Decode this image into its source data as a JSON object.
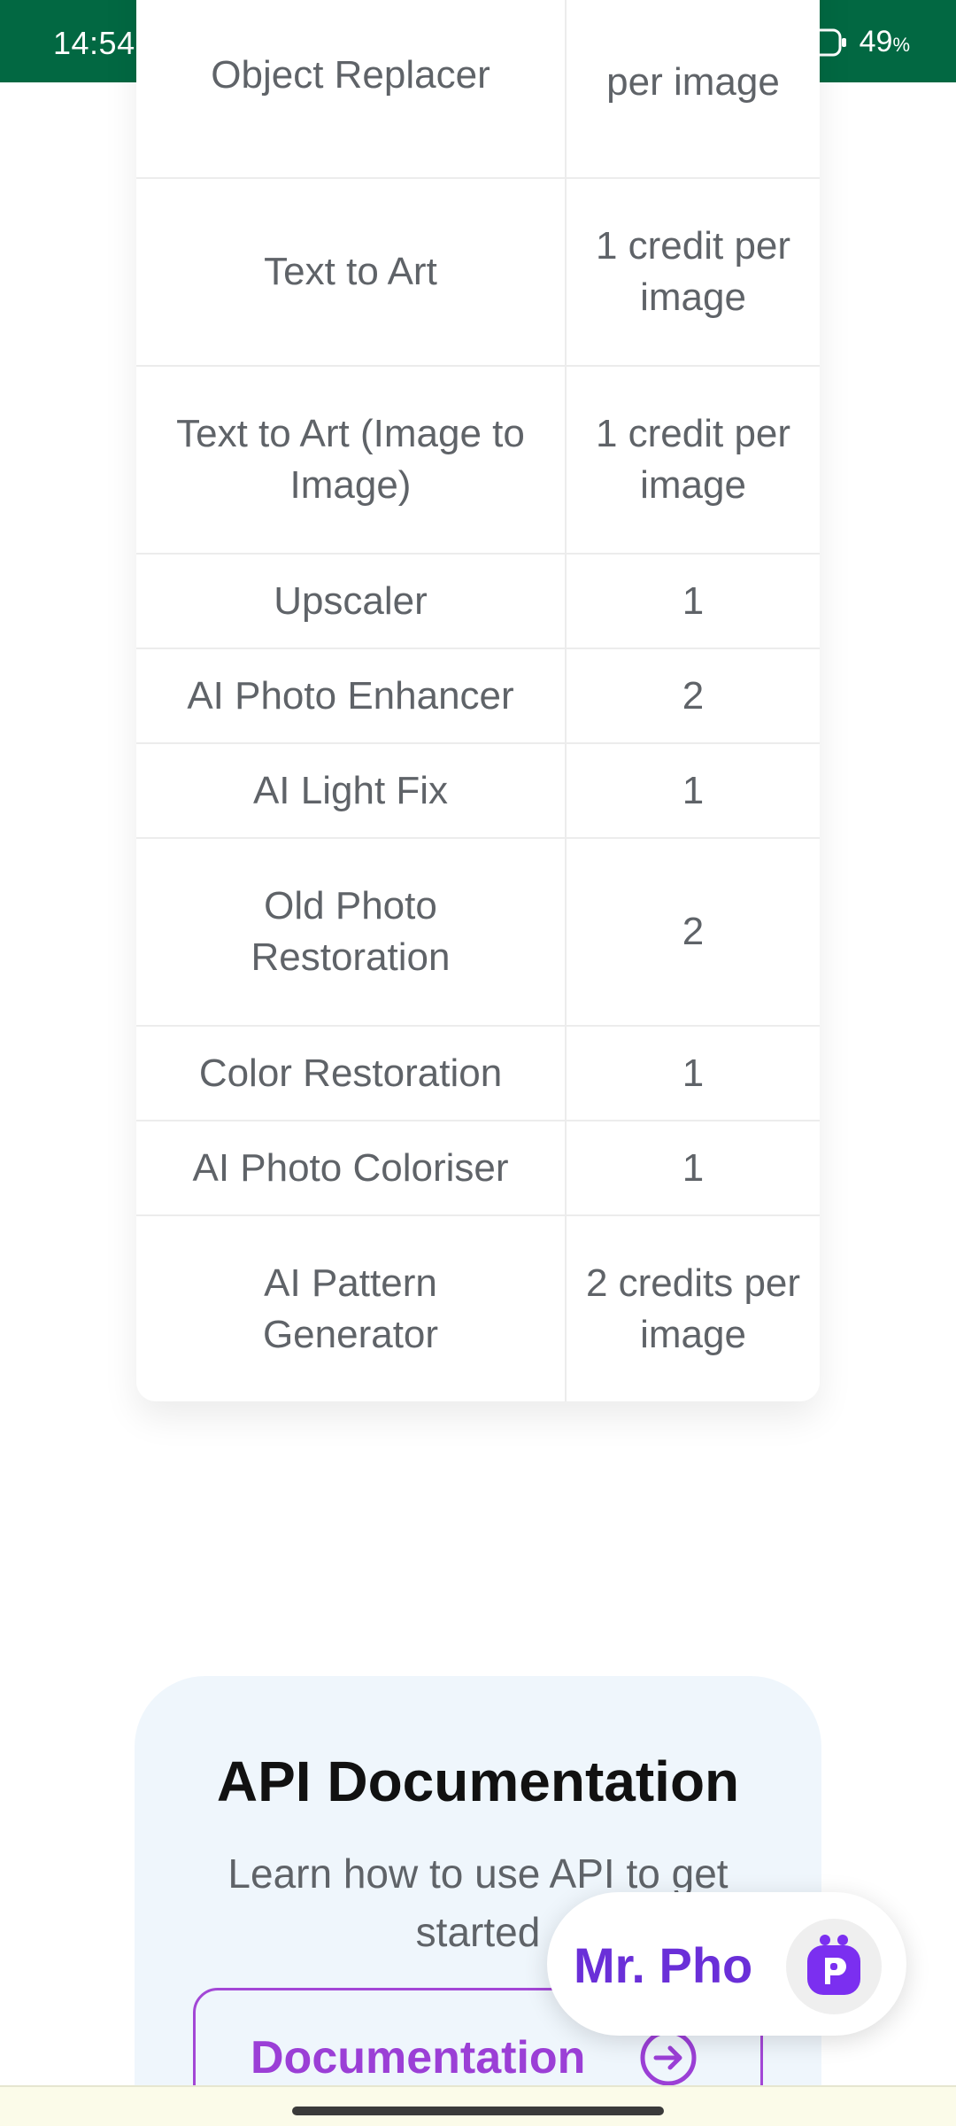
{
  "status_bar": {
    "time": "14:54",
    "battery": "49",
    "battery_unit": "%",
    "icons": [
      "chat-bubble-icon",
      "sim-toolkit-icon",
      "facebook-icon",
      "more-icon",
      "signal-icon",
      "wifi-icon",
      "battery-icon"
    ]
  },
  "credits_table": {
    "rows": [
      {
        "tool": "Object Replacer",
        "cost": "per image"
      },
      {
        "tool": "Text to Art",
        "cost": "1 credit per image"
      },
      {
        "tool": "Text to Art (Image to Image)",
        "cost": "1 credit per image"
      },
      {
        "tool": "Upscaler",
        "cost": "1"
      },
      {
        "tool": "AI Photo Enhancer",
        "cost": "2"
      },
      {
        "tool": "AI Light Fix",
        "cost": "1"
      },
      {
        "tool": "Old Photo Restoration",
        "cost": "2"
      },
      {
        "tool": "Color Restoration",
        "cost": "1"
      },
      {
        "tool": "AI Photo Coloriser",
        "cost": "1"
      },
      {
        "tool": "AI Pattern Generator",
        "cost": "2 credits per image"
      }
    ]
  },
  "api_section": {
    "title": "API Documentation",
    "subtitle": "Learn how to use API to get started",
    "button_label": "Documentation",
    "button_icon": "arrow-right-circle-icon"
  },
  "chat_widget": {
    "label": "Mr. Pho",
    "avatar_icon": "robot-p-icon"
  },
  "colors": {
    "status_bar": "#026842",
    "accent_purple": "#9b3fd6",
    "chat_purple": "#6a2fd8",
    "api_bg": "#eff6fc"
  }
}
